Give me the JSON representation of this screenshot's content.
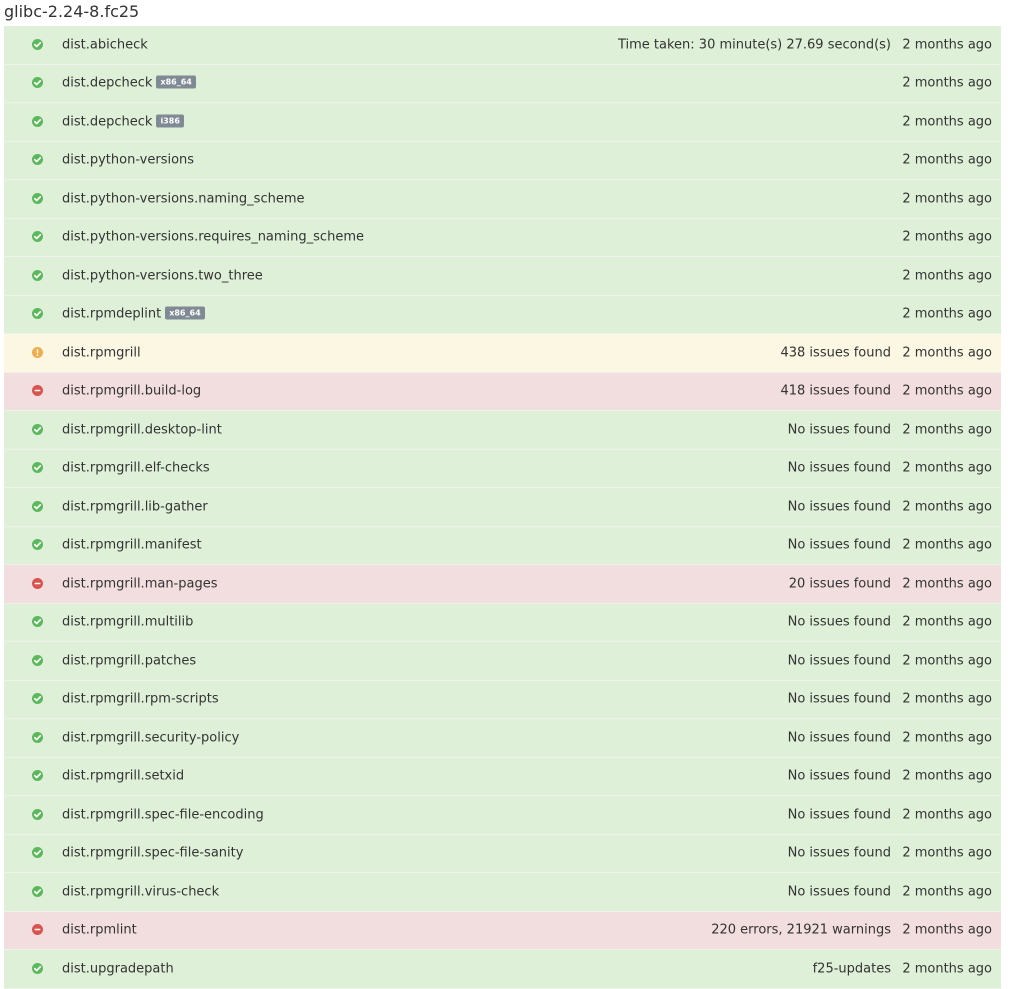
{
  "title": "glibc-2.24-8.fc25",
  "colors": {
    "pass_bg": "#dff0d8",
    "info_bg": "#fbf7e3",
    "fail_bg": "#f2dede",
    "pass_icon": "#5cb85c",
    "info_icon": "#f0ad4e",
    "fail_icon": "#d9534f",
    "badge_bg": "#7f8a95"
  },
  "rows": [
    {
      "status": "pass",
      "icon": "check-circle-icon",
      "name": "dist.abicheck",
      "badge": "",
      "note": "Time taken: 30 minute(s) 27.69 second(s)",
      "time": "2 months ago"
    },
    {
      "status": "pass",
      "icon": "check-circle-icon",
      "name": "dist.depcheck",
      "badge": "x86_64",
      "note": "",
      "time": "2 months ago"
    },
    {
      "status": "pass",
      "icon": "check-circle-icon",
      "name": "dist.depcheck",
      "badge": "i386",
      "note": "",
      "time": "2 months ago"
    },
    {
      "status": "pass",
      "icon": "check-circle-icon",
      "name": "dist.python-versions",
      "badge": "",
      "note": "",
      "time": "2 months ago"
    },
    {
      "status": "pass",
      "icon": "check-circle-icon",
      "name": "dist.python-versions.naming_scheme",
      "badge": "",
      "note": "",
      "time": "2 months ago"
    },
    {
      "status": "pass",
      "icon": "check-circle-icon",
      "name": "dist.python-versions.requires_naming_scheme",
      "badge": "",
      "note": "",
      "time": "2 months ago"
    },
    {
      "status": "pass",
      "icon": "check-circle-icon",
      "name": "dist.python-versions.two_three",
      "badge": "",
      "note": "",
      "time": "2 months ago"
    },
    {
      "status": "pass",
      "icon": "check-circle-icon",
      "name": "dist.rpmdeplint",
      "badge": "x86_64",
      "note": "",
      "time": "2 months ago"
    },
    {
      "status": "info",
      "icon": "exclamation-circle-icon",
      "name": "dist.rpmgrill",
      "badge": "",
      "note": "438 issues found",
      "time": "2 months ago"
    },
    {
      "status": "fail",
      "icon": "minus-circle-icon",
      "name": "dist.rpmgrill.build-log",
      "badge": "",
      "note": "418 issues found",
      "time": "2 months ago"
    },
    {
      "status": "pass",
      "icon": "check-circle-icon",
      "name": "dist.rpmgrill.desktop-lint",
      "badge": "",
      "note": "No issues found",
      "time": "2 months ago"
    },
    {
      "status": "pass",
      "icon": "check-circle-icon",
      "name": "dist.rpmgrill.elf-checks",
      "badge": "",
      "note": "No issues found",
      "time": "2 months ago"
    },
    {
      "status": "pass",
      "icon": "check-circle-icon",
      "name": "dist.rpmgrill.lib-gather",
      "badge": "",
      "note": "No issues found",
      "time": "2 months ago"
    },
    {
      "status": "pass",
      "icon": "check-circle-icon",
      "name": "dist.rpmgrill.manifest",
      "badge": "",
      "note": "No issues found",
      "time": "2 months ago"
    },
    {
      "status": "fail",
      "icon": "minus-circle-icon",
      "name": "dist.rpmgrill.man-pages",
      "badge": "",
      "note": "20 issues found",
      "time": "2 months ago"
    },
    {
      "status": "pass",
      "icon": "check-circle-icon",
      "name": "dist.rpmgrill.multilib",
      "badge": "",
      "note": "No issues found",
      "time": "2 months ago"
    },
    {
      "status": "pass",
      "icon": "check-circle-icon",
      "name": "dist.rpmgrill.patches",
      "badge": "",
      "note": "No issues found",
      "time": "2 months ago"
    },
    {
      "status": "pass",
      "icon": "check-circle-icon",
      "name": "dist.rpmgrill.rpm-scripts",
      "badge": "",
      "note": "No issues found",
      "time": "2 months ago"
    },
    {
      "status": "pass",
      "icon": "check-circle-icon",
      "name": "dist.rpmgrill.security-policy",
      "badge": "",
      "note": "No issues found",
      "time": "2 months ago"
    },
    {
      "status": "pass",
      "icon": "check-circle-icon",
      "name": "dist.rpmgrill.setxid",
      "badge": "",
      "note": "No issues found",
      "time": "2 months ago"
    },
    {
      "status": "pass",
      "icon": "check-circle-icon",
      "name": "dist.rpmgrill.spec-file-encoding",
      "badge": "",
      "note": "No issues found",
      "time": "2 months ago"
    },
    {
      "status": "pass",
      "icon": "check-circle-icon",
      "name": "dist.rpmgrill.spec-file-sanity",
      "badge": "",
      "note": "No issues found",
      "time": "2 months ago"
    },
    {
      "status": "pass",
      "icon": "check-circle-icon",
      "name": "dist.rpmgrill.virus-check",
      "badge": "",
      "note": "No issues found",
      "time": "2 months ago"
    },
    {
      "status": "fail",
      "icon": "minus-circle-icon",
      "name": "dist.rpmlint",
      "badge": "",
      "note": "220 errors, 21921 warnings",
      "time": "2 months ago"
    },
    {
      "status": "pass",
      "icon": "check-circle-icon",
      "name": "dist.upgradepath",
      "badge": "",
      "note": "f25-updates",
      "time": "2 months ago"
    }
  ]
}
